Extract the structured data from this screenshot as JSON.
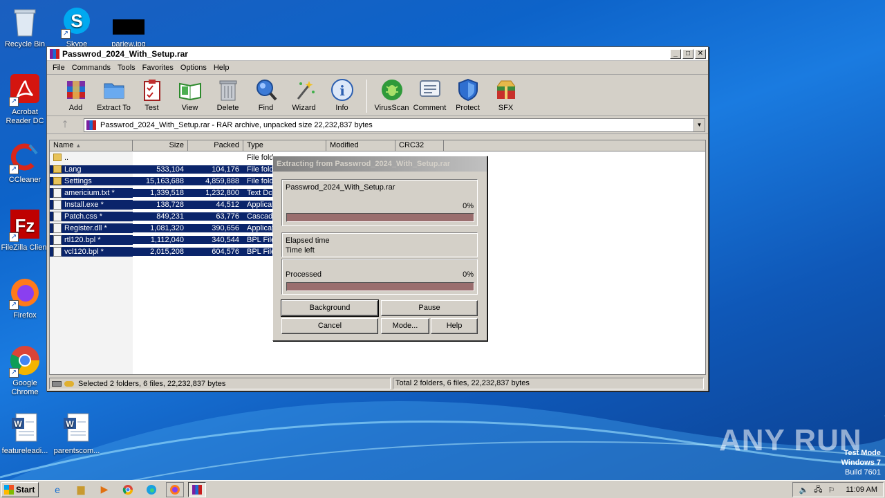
{
  "desktop": {
    "icons": [
      {
        "label": "Recycle Bin",
        "icon": "recycle-bin-icon"
      },
      {
        "label": "Skype",
        "icon": "skype-icon"
      },
      {
        "label": "pariew.jpg",
        "icon": "image-file-icon"
      },
      {
        "label": "Acrobat Reader DC",
        "icon": "acrobat-icon"
      },
      {
        "label": "CCleaner",
        "icon": "ccleaner-icon"
      },
      {
        "label": "FileZilla Client",
        "icon": "filezilla-icon"
      },
      {
        "label": "Firefox",
        "icon": "firefox-icon"
      },
      {
        "label": "Google Chrome",
        "icon": "chrome-icon"
      },
      {
        "label": "featureleadi...",
        "icon": "word-doc-icon"
      },
      {
        "label": "parentscom...",
        "icon": "word-doc-icon"
      }
    ],
    "watermark": "ANY RUN",
    "test_mode": {
      "line1": "Test Mode",
      "line2": "Windows 7",
      "line3": "Build 7601"
    }
  },
  "window": {
    "title": "Passwrod_2024_With_Setup.rar",
    "controls": {
      "minimize": "_",
      "maximize": "□",
      "close": "✕"
    },
    "menu": [
      "File",
      "Commands",
      "Tools",
      "Favorites",
      "Options",
      "Help"
    ],
    "toolbar": [
      {
        "label": "Add",
        "icon": "add-archive-icon"
      },
      {
        "label": "Extract To",
        "icon": "extract-folder-icon"
      },
      {
        "label": "Test",
        "icon": "test-clipboard-icon"
      },
      {
        "label": "View",
        "icon": "view-book-icon"
      },
      {
        "label": "Delete",
        "icon": "trash-can-icon"
      },
      {
        "label": "Find",
        "icon": "magnifier-icon"
      },
      {
        "label": "Wizard",
        "icon": "magic-wand-icon"
      },
      {
        "label": "Info",
        "icon": "info-icon"
      },
      {
        "label": "VirusScan",
        "icon": "virus-bug-icon"
      },
      {
        "label": "Comment",
        "icon": "comment-icon"
      },
      {
        "label": "Protect",
        "icon": "shield-icon"
      },
      {
        "label": "SFX",
        "icon": "sfx-box-icon"
      }
    ],
    "address": "Passwrod_2024_With_Setup.rar - RAR archive, unpacked size 22,232,837 bytes",
    "columns": [
      "Name",
      "Size",
      "Packed",
      "Type",
      "Modified",
      "CRC32"
    ],
    "rows": [
      {
        "name": "..",
        "size": "",
        "packed": "",
        "type": "File fold",
        "kind": "folder",
        "selected": false
      },
      {
        "name": "Lang",
        "size": "533,104",
        "packed": "104,176",
        "type": "File fold",
        "kind": "folder",
        "selected": true
      },
      {
        "name": "Settings",
        "size": "15,163,688",
        "packed": "4,859,888",
        "type": "File fold",
        "kind": "folder",
        "selected": true
      },
      {
        "name": "americium.txt *",
        "size": "1,339,518",
        "packed": "1,232,800",
        "type": "Text Dc",
        "kind": "file",
        "selected": true
      },
      {
        "name": "Install.exe *",
        "size": "138,728",
        "packed": "44,512",
        "type": "Applicat",
        "kind": "file",
        "selected": true
      },
      {
        "name": "Patch.css *",
        "size": "849,231",
        "packed": "63,776",
        "type": "Cascadi",
        "kind": "file",
        "selected": true
      },
      {
        "name": "Register.dll *",
        "size": "1,081,320",
        "packed": "390,656",
        "type": "Applicat",
        "kind": "file",
        "selected": true
      },
      {
        "name": "rtl120.bpl *",
        "size": "1,112,040",
        "packed": "340,544",
        "type": "BPL File",
        "kind": "file",
        "selected": true
      },
      {
        "name": "vcl120.bpl *",
        "size": "2,015,208",
        "packed": "604,576",
        "type": "BPL File",
        "kind": "file",
        "selected": true
      }
    ],
    "status_left": "Selected 2 folders, 6 files, 22,232,837 bytes",
    "status_right": "Total 2 folders, 6 files, 22,232,837 bytes"
  },
  "dialog": {
    "title": "Extracting from Passwrod_2024_With_Setup.rar",
    "file": "Passwrod_2024_With_Setup.rar",
    "file_percent": "0%",
    "file_progress": 1.0,
    "elapsed_label": "Elapsed time",
    "left_label": "Time left",
    "processed_label": "Processed",
    "processed_percent": "0%",
    "processed_progress": 1.0,
    "buttons": {
      "background": "Background",
      "pause": "Pause",
      "cancel": "Cancel",
      "mode": "Mode...",
      "help": "Help"
    }
  },
  "taskbar": {
    "start": "Start",
    "clock": "11:09 AM"
  }
}
